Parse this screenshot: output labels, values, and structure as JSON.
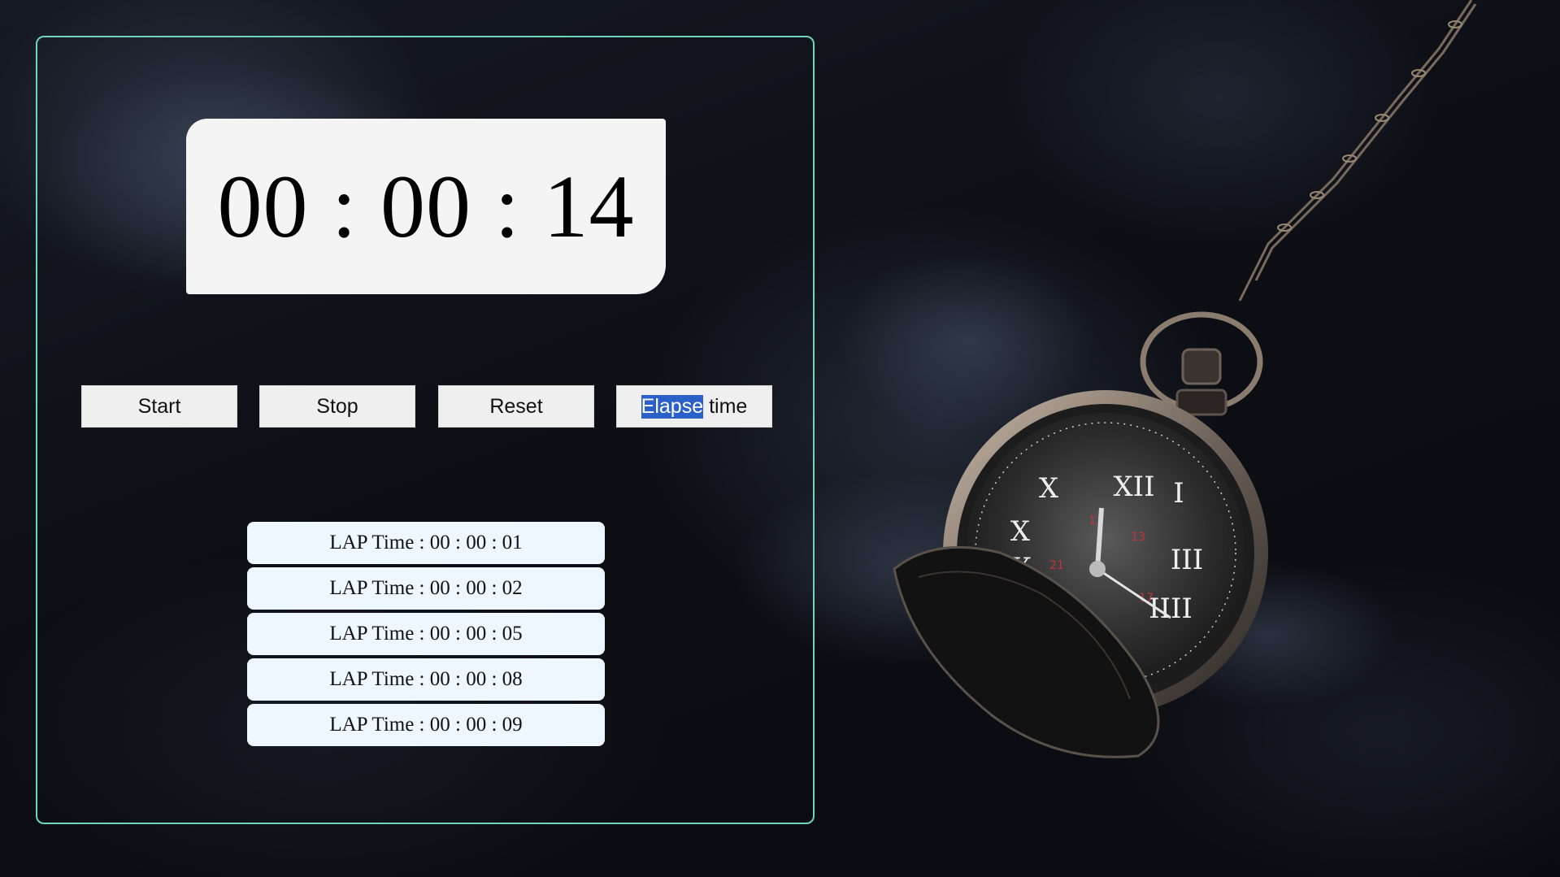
{
  "stopwatch": {
    "display": "00 : 00 : 14"
  },
  "controls": {
    "start_label": "Start",
    "stop_label": "Stop",
    "reset_label": "Reset",
    "elapse_selected": "Elapse",
    "elapse_rest": " time"
  },
  "laps": [
    {
      "label": "LAP Time : 00 : 00 : 01"
    },
    {
      "label": "LAP Time : 00 : 00 : 02"
    },
    {
      "label": "LAP Time : 00 : 00 : 05"
    },
    {
      "label": "LAP Time : 00 : 00 : 08"
    },
    {
      "label": "LAP Time : 00 : 00 : 09"
    }
  ],
  "colors": {
    "panel_border": "#6fd6b8",
    "display_bg": "#f4f4f4",
    "lap_bg": "#eef6ff",
    "selection": "#2b60c9"
  },
  "background": {
    "icon": "pocket-watch-icon"
  }
}
